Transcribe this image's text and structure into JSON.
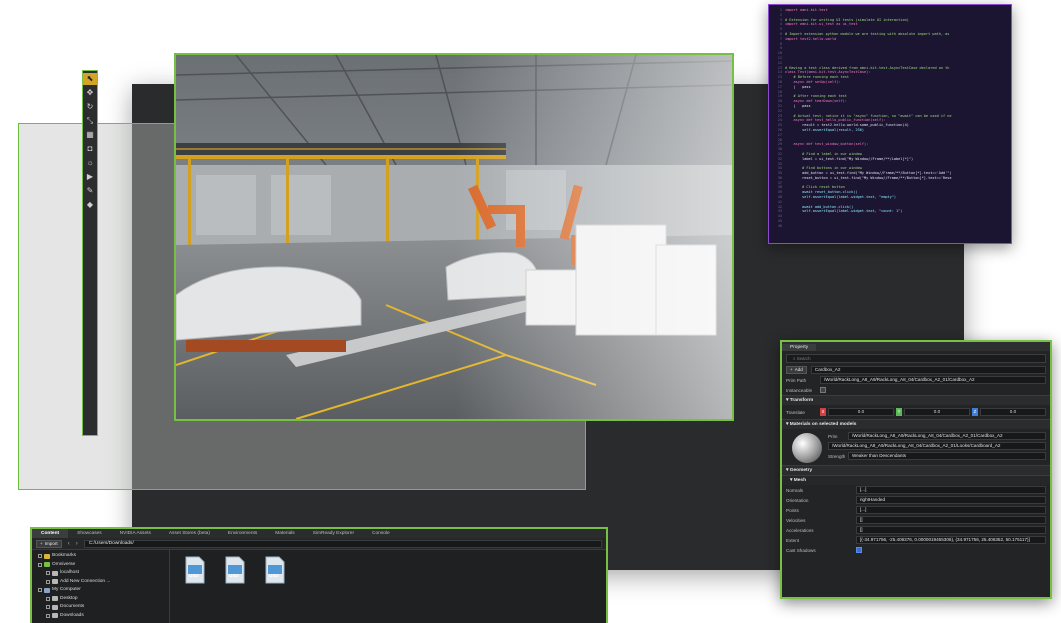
{
  "toolbar": {
    "tools": [
      "select-icon",
      "move-icon",
      "rotate-icon",
      "scale-icon",
      "snap-icon",
      "camera-icon",
      "light-icon",
      "play-icon",
      "paint-icon",
      "physics-icon"
    ]
  },
  "code_editor": {
    "line_numbers": [
      "1",
      "2",
      "3",
      "4",
      "5",
      "6",
      "7",
      "8",
      "9",
      "10",
      "11",
      "12",
      "13",
      "14",
      "15",
      "16",
      "17",
      "18",
      "19",
      "20",
      "21",
      "22",
      "23",
      "24",
      "25",
      "26",
      "27",
      "28",
      "29",
      "30",
      "31",
      "32",
      "33",
      "34",
      "35",
      "36",
      "37",
      "38",
      "39",
      "40",
      "41",
      "42",
      "43",
      "44",
      "45",
      "46"
    ],
    "lines": [
      "import omni.kit.test",
      "",
      "# Extension for writing UI tests (simulate UI interaction)",
      "import omni.kit.ui_test as ui_test",
      "",
      "# Import extension python module we are testing with absolute import path, as",
      "import test2.hello.world",
      "",
      "",
      "",
      "",
      "",
      "# Having a test class derived from omni.kit.test.AsyncTestCase declared on th",
      "class Test(omni.kit.test.AsyncTestCase):",
      "    # Before running each test",
      "    async def setUp(self):",
      "    |   pass",
      "",
      "    # After running each test",
      "    async def tearDown(self):",
      "    |   pass",
      "",
      "    # Actual test, notice it is \"async\" function, so \"await\" can be used if ne",
      "    async def test_hello_public_function(self):",
      "        result = test2.hello.world.some_public_function(4)",
      "        self.assertEqual(result, 256)",
      "",
      "",
      "    async def test_window_button(self):",
      "",
      "        # Find a label in our window",
      "        label = ui_test.find(\"My Window//Frame/**/Label[*]\")",
      "",
      "        # Find buttons in our window",
      "        add_button = ui_test.find(\"My Window//Frame/**/Button[*].text=='Add'\")",
      "        reset_button = ui_test.find(\"My Window//Frame/**/Button[*].text=='Rese",
      "",
      "        # Click reset button",
      "        await reset_button.click()",
      "        self.assertEqual(label.widget.text, \"empty\")",
      "",
      "        await add_button.click()",
      "        self.assertEqual(label.widget.text, \"count: 1\")",
      "",
      "",
      ""
    ]
  },
  "property_panel": {
    "tab": "Property",
    "search_placeholder": "Search",
    "add_label": "Add",
    "name_value": "Cardbox_A2",
    "prim_path_label": "Prim Path",
    "prim_path_value": "/World/RackLong_A8_A9/RackLong_A8_04/Cardbox_A2_01/Cardbox_A2",
    "instanceable_label": "Instanceable",
    "transform_section": "Transform",
    "translate_label": "Translate",
    "translate": {
      "x": "0.0",
      "y": "0.0",
      "z": "0.0"
    },
    "materials_section": "Materials on selected models",
    "prim_label": "Prim",
    "material_prim_value": "/World/RackLong_A8_A9/RackLong_A8_04/Cardbox_A2_01/Cardbox_A2",
    "material_path_value": "/World/RackLong_A8_A9/RackLong_A8_04/Cardbox_A2_01/Looks/Cardboard_A2",
    "strength_label": "Strength",
    "strength_value": "Weaker than Descendants",
    "geometry_section": "Geometry",
    "mesh_section": "Mesh",
    "normals_label": "Normals",
    "normals_value": "[...]",
    "orientation_label": "Orientation",
    "orientation_value": "rightHanded",
    "points_label": "Points",
    "points_value": "[...]",
    "velocities_label": "Velocities",
    "velocities_value": "[]",
    "accelerations_label": "Accelerations",
    "accelerations_value": "[]",
    "extent_label": "Extent",
    "extent_value": "[(-34.971756, -25.406376, 0.0000019465306), (34.971756, 25.406352, 50.175117)]",
    "cast_shadows_label": "Cast Shadows"
  },
  "content_browser": {
    "tabs": [
      "Content",
      "Showcases",
      "NVIDIA Assets",
      "Asset Stores (beta)",
      "Environments",
      "Materials",
      "SimReady Explorer",
      "Console"
    ],
    "import_label": "Import",
    "path": "C:/Users/Downloads/",
    "tree": [
      {
        "label": "Bookmarks",
        "depth": 0
      },
      {
        "label": "Omniverse",
        "depth": 0
      },
      {
        "label": "localhost",
        "depth": 1
      },
      {
        "label": "Add New Connection ...",
        "depth": 1
      },
      {
        "label": "My Computer",
        "depth": 0
      },
      {
        "label": "Desktop",
        "depth": 1
      },
      {
        "label": "Documents",
        "depth": 1
      },
      {
        "label": "Downloads",
        "depth": 1
      }
    ],
    "files": [
      "USD",
      "USD",
      "USD"
    ]
  },
  "colors": {
    "accent_green": "#76c043",
    "editor_border": "#8b4ad1",
    "robot_orange": "#d9692a",
    "floor_line_yellow": "#e3b62c"
  }
}
